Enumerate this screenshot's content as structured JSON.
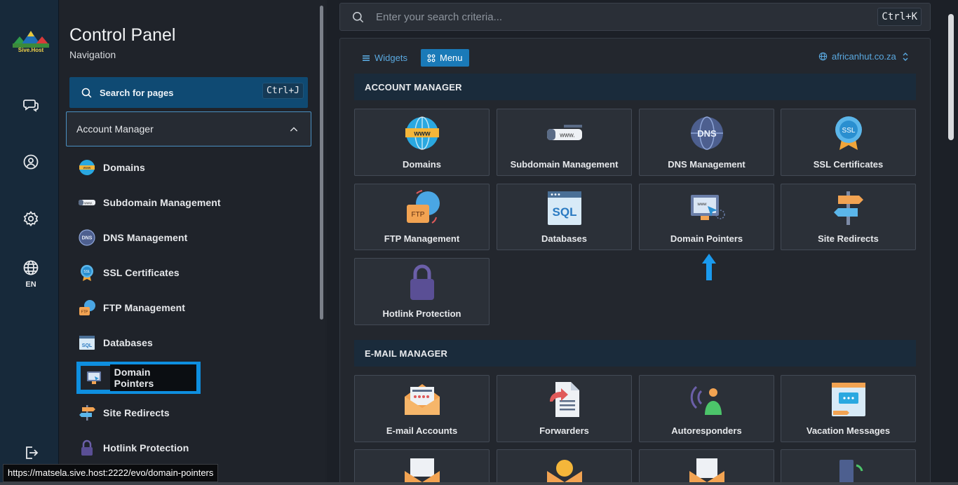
{
  "rail": {
    "logo_text": "Sive.Host",
    "icons": [
      "chat-icon",
      "user-icon",
      "gear-icon",
      "globe-icon",
      "logout-icon"
    ],
    "language": "EN"
  },
  "nav": {
    "title": "Control Panel",
    "subtitle": "Navigation",
    "search_label": "Search for pages",
    "search_shortcut": "Ctrl+J",
    "section_label": "Account Manager",
    "items": [
      {
        "label": "Domains"
      },
      {
        "label": "Subdomain Management"
      },
      {
        "label": "DNS Management"
      },
      {
        "label": "SSL Certificates"
      },
      {
        "label": "FTP Management"
      },
      {
        "label": "Databases"
      },
      {
        "label": "Domain Pointers"
      },
      {
        "label": "Site Redirects"
      },
      {
        "label": "Hotlink Protection"
      }
    ]
  },
  "search": {
    "placeholder": "Enter your search criteria...",
    "shortcut": "Ctrl+K"
  },
  "toolbar": {
    "widgets_label": "Widgets",
    "menu_label": "Menu",
    "domain": "africanhut.co.za"
  },
  "sections": {
    "account_manager": {
      "title": "ACCOUNT MANAGER",
      "cards": [
        {
          "label": "Domains"
        },
        {
          "label": "Subdomain Management"
        },
        {
          "label": "DNS Management"
        },
        {
          "label": "SSL Certificates"
        },
        {
          "label": "FTP Management"
        },
        {
          "label": "Databases"
        },
        {
          "label": "Domain Pointers"
        },
        {
          "label": "Site Redirects"
        },
        {
          "label": "Hotlink Protection"
        }
      ]
    },
    "email_manager": {
      "title": "E-MAIL MANAGER",
      "cards": [
        {
          "label": "E-mail Accounts"
        },
        {
          "label": "Forwarders"
        },
        {
          "label": "Autoresponders"
        },
        {
          "label": "Vacation Messages"
        }
      ]
    }
  },
  "status_bar": {
    "url": "https://matsela.sive.host:2222/evo/domain-pointers"
  },
  "colors": {
    "accent": "#1a7ab8",
    "highlight": "#0e8fe0",
    "rail_bg": "#17293a",
    "section_bg": "#1a2b3b"
  }
}
